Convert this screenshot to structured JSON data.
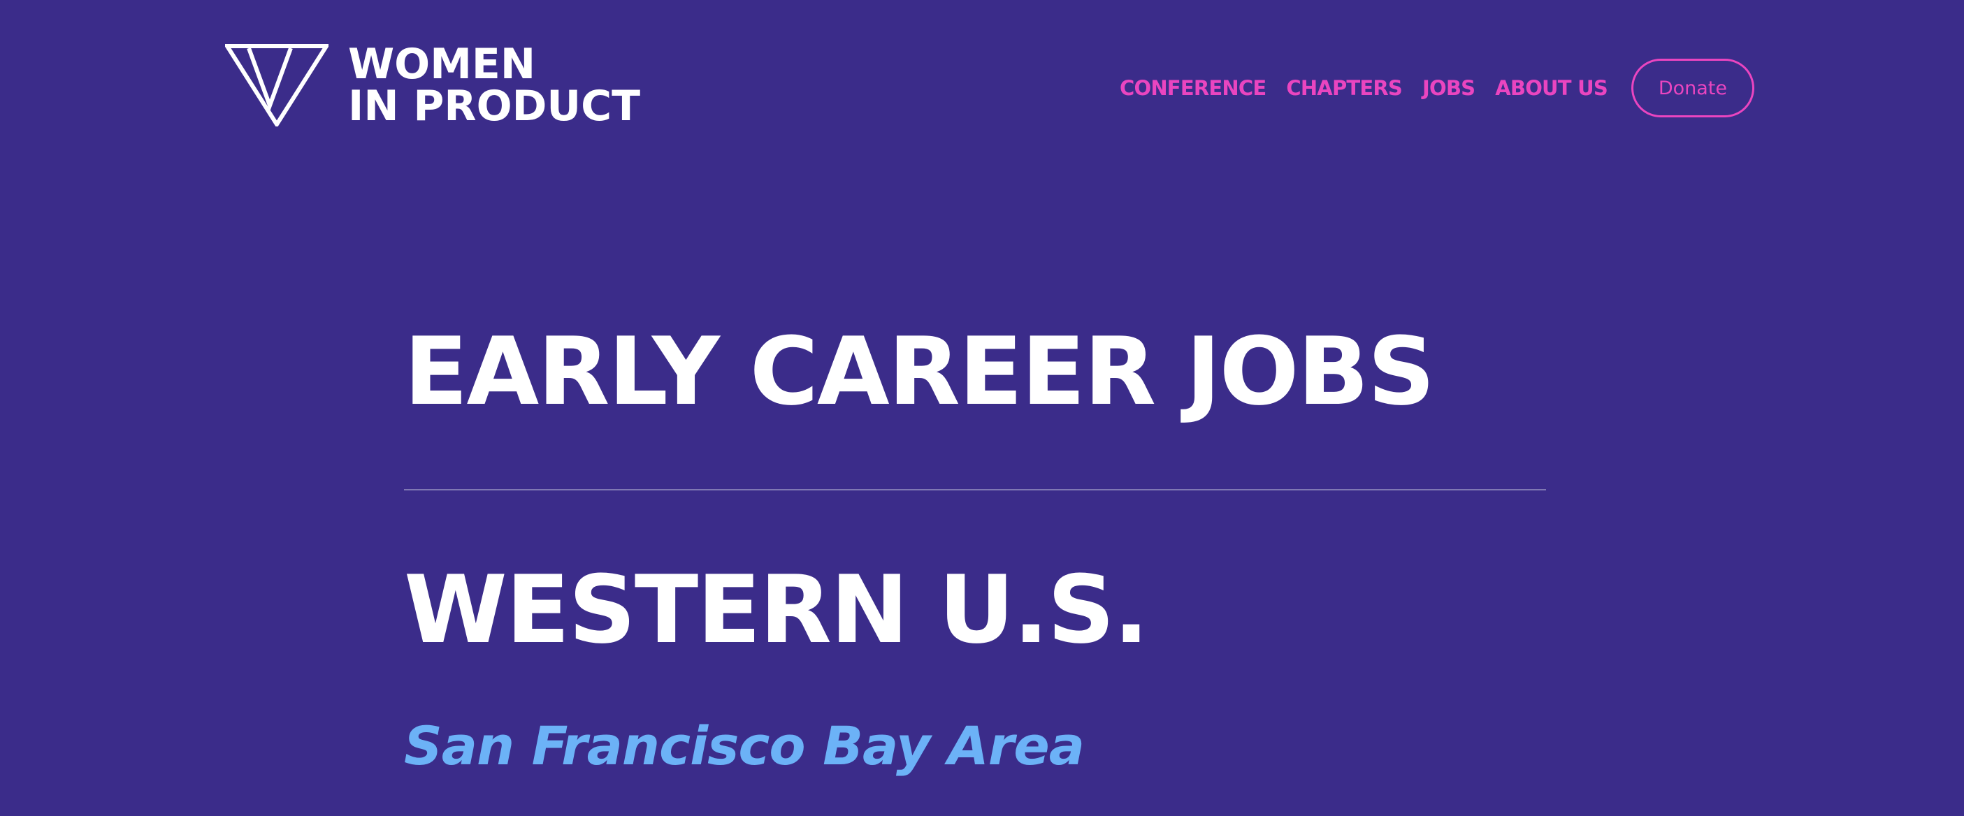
{
  "colors": {
    "background": "#3b2c8a",
    "accent_pink": "#ea45c0",
    "heading_white": "#ffffff",
    "subheading_blue": "#6cb2f7"
  },
  "header": {
    "logo": {
      "icon": "w-triangle-logo-icon",
      "line1": "WOMEN",
      "line2": "IN PRODUCT"
    },
    "nav": [
      {
        "label": "CONFERENCE"
      },
      {
        "label": "CHAPTERS"
      },
      {
        "label": "JOBS"
      },
      {
        "label": "ABOUT US"
      }
    ],
    "donate_label": "Donate"
  },
  "main": {
    "title": "EARLY CAREER JOBS",
    "region": "WESTERN U.S.",
    "area": "San Francisco Bay Area"
  }
}
